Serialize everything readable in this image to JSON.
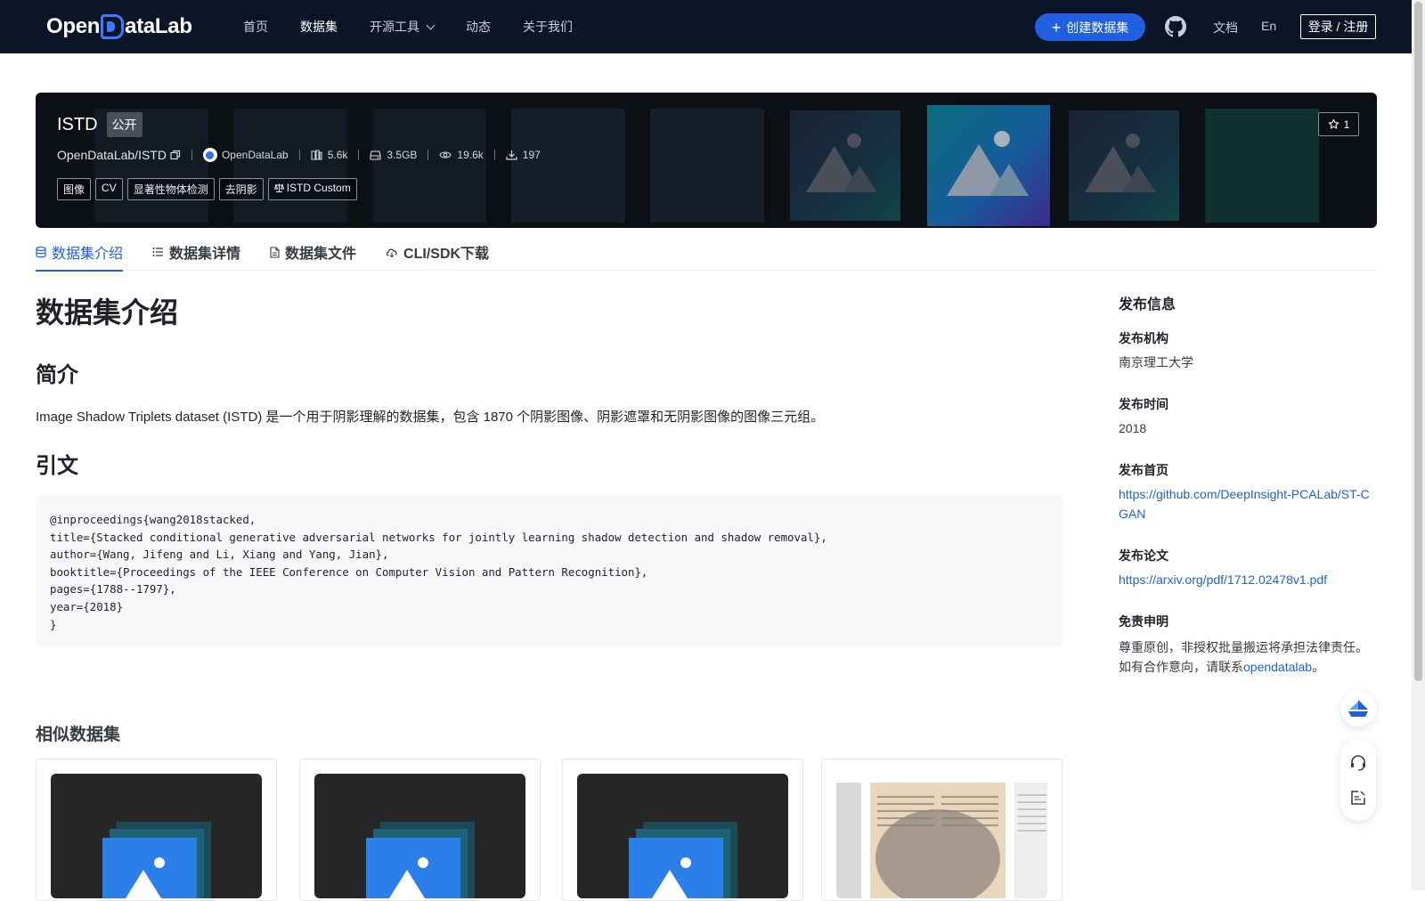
{
  "nav": {
    "logo_text_a": "Open",
    "logo_text_b": "ataLab",
    "links": [
      "首页",
      "数据集",
      "开源工具",
      "动态",
      "关于我们"
    ],
    "create_label": "创建数据集",
    "docs_label": "文档",
    "lang_label": "En",
    "login_label": "登录 / 注册"
  },
  "hero": {
    "name": "ISTD",
    "visibility": "公开",
    "path": "OpenDataLab/ISTD",
    "org": "OpenDataLab",
    "stats": {
      "size_count": "5.6k",
      "disk": "3.5GB",
      "views": "19.6k",
      "downloads": "197"
    },
    "tags": [
      "图像",
      "CV",
      "显著性物体检测",
      "去阴影",
      "ISTD Custom"
    ],
    "stars": "1"
  },
  "tabs": [
    "数据集介绍",
    "数据集详情",
    "数据集文件",
    "CLI/SDK下载"
  ],
  "content": {
    "title": "数据集介绍",
    "intro_heading": "简介",
    "intro_text": "Image Shadow Triplets dataset (ISTD) 是一个用于阴影理解的数据集，包含 1870 个阴影图像、阴影遮罩和无阴影图像的图像三元组。",
    "citation_heading": "引文",
    "citation": "@inproceedings{wang2018stacked,\ntitle={Stacked conditional generative adversarial networks for jointly learning shadow detection and shadow removal},\nauthor={Wang, Jifeng and Li, Xiang and Yang, Jian},\nbooktitle={Proceedings of the IEEE Conference on Computer Vision and Pattern Recognition},\npages={1788--1797},\nyear={2018}\n}",
    "similar_heading": "相似数据集"
  },
  "sidebar": {
    "title": "发布信息",
    "org_label": "发布机构",
    "org_value": "南京理工大学",
    "time_label": "发布时间",
    "time_value": "2018",
    "home_label": "发布首页",
    "home_value": "https://github.com/DeepInsight-PCALab/ST-CGAN",
    "paper_label": "发布论文",
    "paper_value": "https://arxiv.org/pdf/1712.02478v1.pdf",
    "disclaimer_label": "免责申明",
    "disclaimer_text_1": "尊重原创，非授权批量搬运将承担法律责任。",
    "disclaimer_text_2": "如有合作意向，请联系",
    "disclaimer_link": "opendatalab",
    "disclaimer_end": "。"
  },
  "colors": {
    "nav_bg": "#0b1527",
    "accent": "#1f5fe0",
    "hero_bg": "#0c0f14"
  },
  "icons": [
    "github-icon",
    "star-icon",
    "database-icon",
    "list-icon",
    "file-icon",
    "cloud-icon",
    "headset-icon",
    "edit-icon",
    "sailboat-icon"
  ]
}
